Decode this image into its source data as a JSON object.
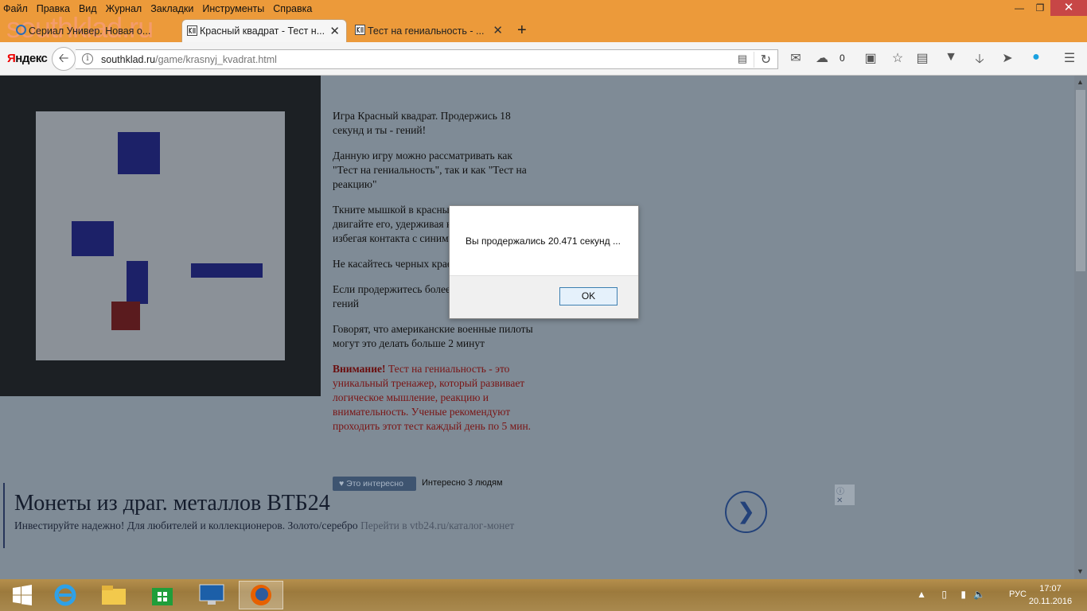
{
  "menu": [
    "Файл",
    "Правка",
    "Вид",
    "Журнал",
    "Закладки",
    "Инструменты",
    "Справка"
  ],
  "watermark": "southklad.ru",
  "tabs": [
    {
      "title": "Сериал Универ. Новая о..."
    },
    {
      "title": "Красный квадрат - Тест н..."
    },
    {
      "title": "Тест на гениальность - ..."
    }
  ],
  "navbar": {
    "brand_y": "Я",
    "brand_rest": "ндекс",
    "url_host": "southklad.ru",
    "url_path": "/game/krasnyj_kvadrat.html",
    "weather_temp": "0"
  },
  "article": {
    "p1": "Игра Красный квадрат. Продержись 18 секунд и ты - гений!",
    "p2": "Данную игру можно рассматривать как \"Тест на гениальность\", так и как \"Тест на реакцию\"",
    "p3": "Ткните мышкой в красный квадрат и двигайте его, удерживая кнопку мыши и избегая контакта с синими квадратами",
    "p4": "Не касайтесь черных краев поля",
    "p5": "Если продержитесь более 18 секунд - вы гений",
    "p6": "Говорят, что американские военные пилоты могут это делать больше 2 минут",
    "warn_label": "Внимание!",
    "warn_text": " Тест на гениальность - это уникальный тренажер, который развивает логическое мышление, реакцию и внимательность. Ученые рекомендуют проходить этот тест каждый день по 5 мин."
  },
  "like": {
    "button": "Это интересно",
    "count_text": "Интересно 3 людям"
  },
  "ad": {
    "title": "Монеты из драг. металлов ВТБ24",
    "text": "Инвестируйте надежно! Для любителей и коллекционеров. Золото/серебро ",
    "link": "Перейти в vtb24.ru/каталог-монет",
    "info": "ⓘ ✕"
  },
  "dialog": {
    "message": "Вы продержались 20.471 секунд ...",
    "ok": "OK"
  },
  "taskbar": {
    "lang": "РУС",
    "time": "17:07",
    "date": "20.11.2016"
  }
}
